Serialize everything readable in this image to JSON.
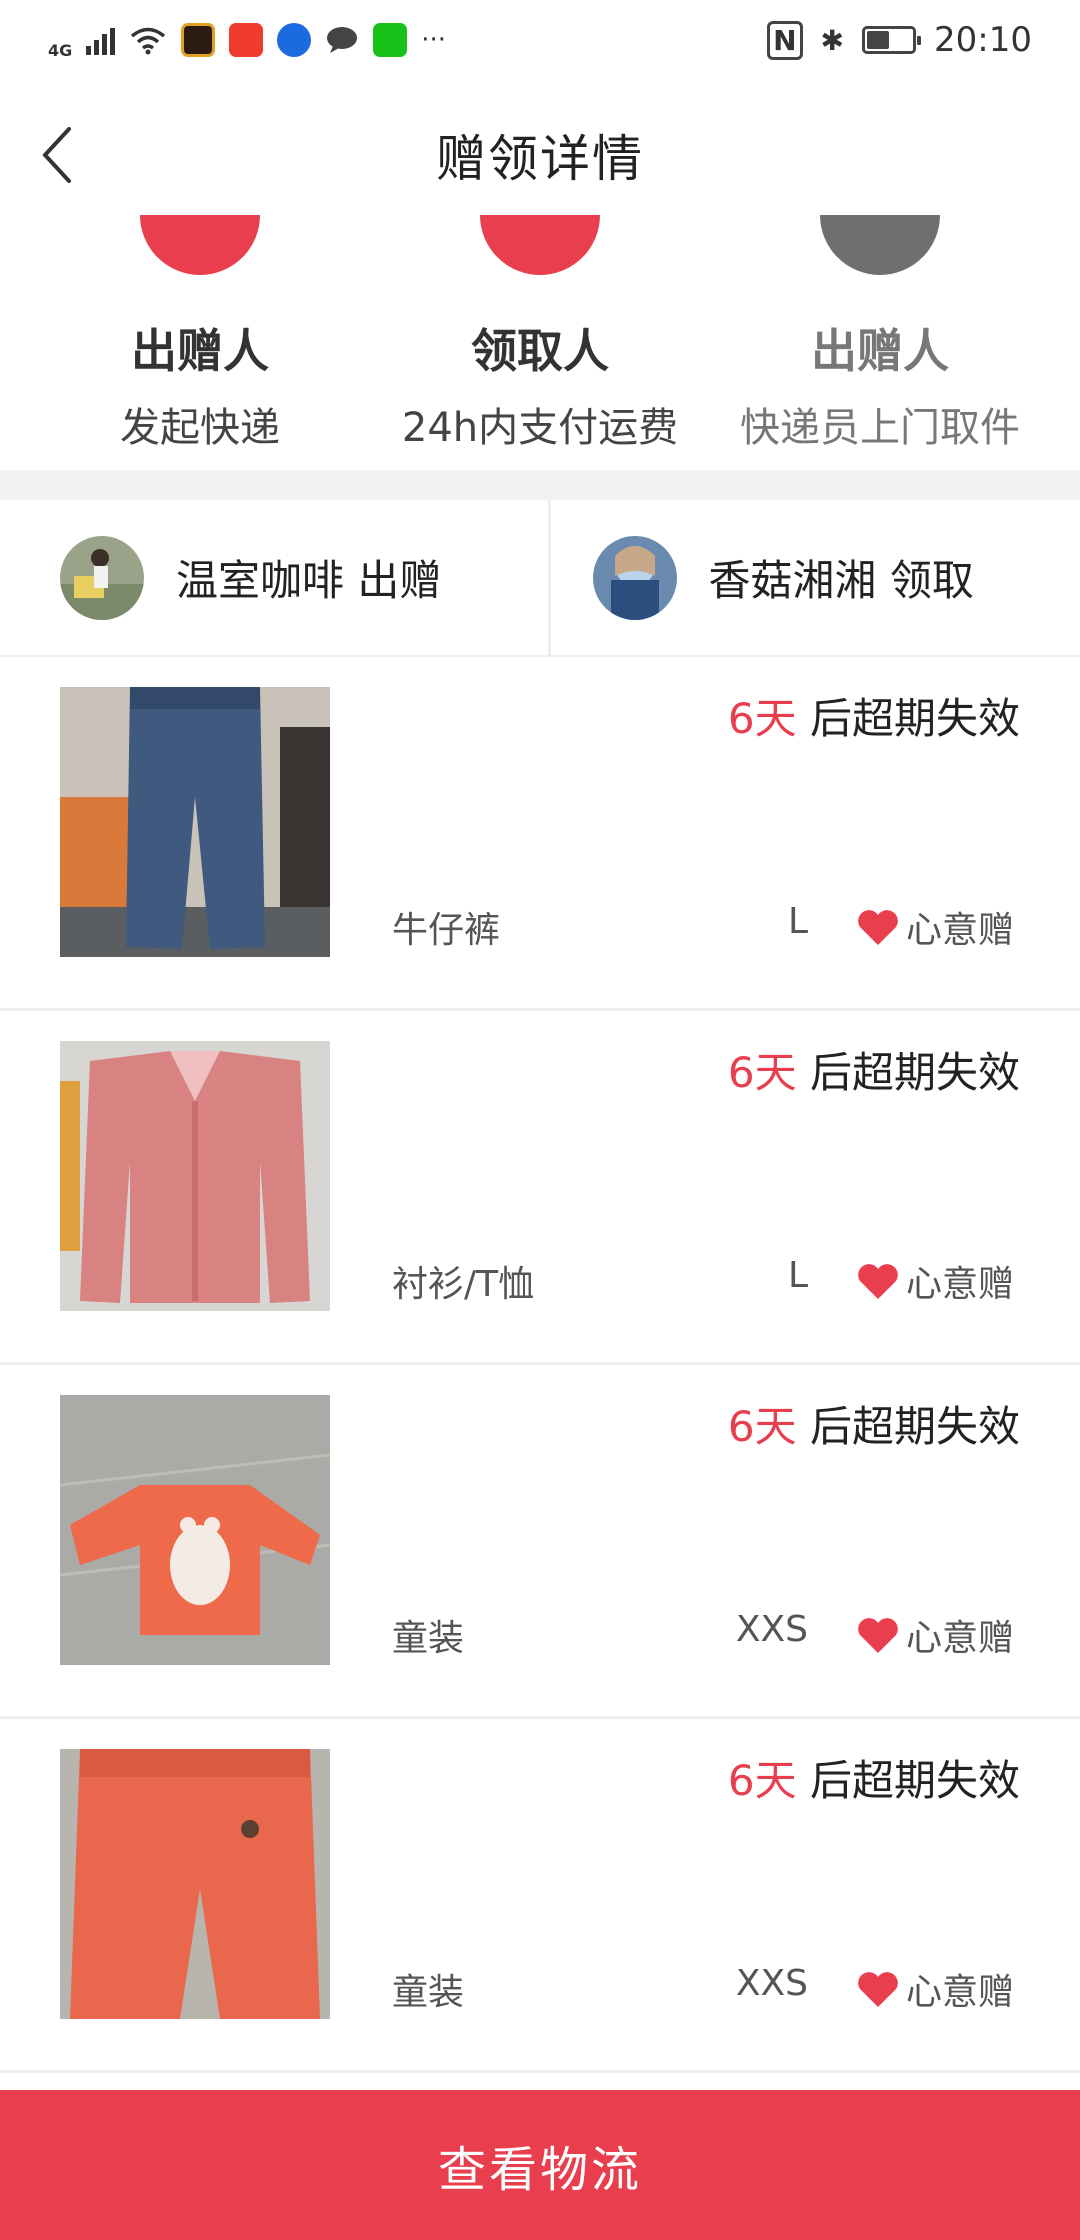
{
  "status_bar": {
    "network": "4G",
    "more": "···",
    "time": "20:10",
    "nfc": "N",
    "bluetooth": "✱",
    "battery_level": 0.45
  },
  "nav": {
    "title": "赠领详情"
  },
  "steps": [
    {
      "role": "出赠人",
      "desc": "发起快递",
      "active": true
    },
    {
      "role": "领取人",
      "desc": "24h内支付运费",
      "active": true
    },
    {
      "role": "出赠人",
      "desc": "快递员上门取件",
      "active": false
    }
  ],
  "users": {
    "giver": {
      "name": "温室咖啡 出赠"
    },
    "receiver": {
      "name": "香菇湘湘 领取"
    }
  },
  "items": [
    {
      "days": "6天",
      "expire_suffix": " 后超期失效",
      "category": "牛仔裤",
      "size": "L",
      "tag": "心意赠",
      "thumb_color": "#3f5a7e"
    },
    {
      "days": "6天",
      "expire_suffix": " 后超期失效",
      "category": "衬衫/T恤",
      "size": "L",
      "tag": "心意赠",
      "thumb_color": "#d98282"
    },
    {
      "days": "6天",
      "expire_suffix": " 后超期失效",
      "category": "童装",
      "size": "XXS",
      "tag": "心意赠",
      "thumb_color": "#ee6a4a"
    },
    {
      "days": "6天",
      "expire_suffix": " 后超期失效",
      "category": "童装",
      "size": "XXS",
      "tag": "心意赠",
      "thumb_color": "#e8674d"
    }
  ],
  "bottom_button": "查看物流",
  "colors": {
    "accent": "#e83e4e",
    "inactive": "#6f6f6f"
  }
}
